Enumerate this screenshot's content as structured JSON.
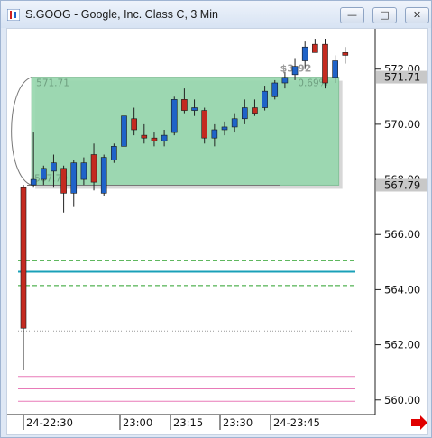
{
  "window": {
    "title": "S.GOOG - Google, Inc. Class C, 3 Min",
    "buttons": {
      "minimize": "—",
      "restore": "□",
      "close": "✕"
    }
  },
  "chart_data": {
    "type": "candlestick",
    "title": "",
    "xlabel": "",
    "ylabel": "",
    "ylim": [
      559.6,
      573.2
    ],
    "y_ticks": [
      560.0,
      562.0,
      564.0,
      566.0,
      568.0,
      570.0,
      572.0
    ],
    "x_ticks": [
      "24-22:30",
      "23:00",
      "23:15",
      "23:30",
      "24-23:45"
    ],
    "candles": [
      {
        "t": "22:30",
        "o": 567.7,
        "h": 567.8,
        "l": 561.1,
        "c": 562.6
      },
      {
        "t": "22:33",
        "o": 567.8,
        "h": 569.7,
        "l": 567.7,
        "c": 568.0
      },
      {
        "t": "22:36",
        "o": 568.0,
        "h": 568.5,
        "l": 567.8,
        "c": 568.4
      },
      {
        "t": "22:39",
        "o": 568.3,
        "h": 568.9,
        "l": 567.7,
        "c": 568.6
      },
      {
        "t": "22:42",
        "o": 568.4,
        "h": 568.5,
        "l": 566.8,
        "c": 567.5
      },
      {
        "t": "22:45",
        "o": 567.5,
        "h": 568.7,
        "l": 567.0,
        "c": 568.6
      },
      {
        "t": "22:48",
        "o": 568.0,
        "h": 568.8,
        "l": 567.8,
        "c": 568.6
      },
      {
        "t": "22:51",
        "o": 568.9,
        "h": 569.3,
        "l": 567.6,
        "c": 567.9
      },
      {
        "t": "22:54",
        "o": 567.5,
        "h": 568.9,
        "l": 567.4,
        "c": 568.8
      },
      {
        "t": "22:57",
        "o": 568.7,
        "h": 569.3,
        "l": 568.6,
        "c": 569.2
      },
      {
        "t": "23:00",
        "o": 569.2,
        "h": 570.6,
        "l": 569.1,
        "c": 570.3
      },
      {
        "t": "23:03",
        "o": 570.2,
        "h": 570.6,
        "l": 569.6,
        "c": 569.8
      },
      {
        "t": "23:06",
        "o": 569.6,
        "h": 570.0,
        "l": 569.3,
        "c": 569.5
      },
      {
        "t": "23:09",
        "o": 569.5,
        "h": 569.7,
        "l": 569.2,
        "c": 569.4
      },
      {
        "t": "23:12",
        "o": 569.4,
        "h": 569.8,
        "l": 569.2,
        "c": 569.6
      },
      {
        "t": "23:15",
        "o": 569.7,
        "h": 571.0,
        "l": 569.6,
        "c": 570.9
      },
      {
        "t": "23:18",
        "o": 570.9,
        "h": 571.3,
        "l": 570.4,
        "c": 570.5
      },
      {
        "t": "23:21",
        "o": 570.5,
        "h": 570.9,
        "l": 570.3,
        "c": 570.6
      },
      {
        "t": "23:24",
        "o": 570.5,
        "h": 570.6,
        "l": 569.3,
        "c": 569.5
      },
      {
        "t": "23:27",
        "o": 569.5,
        "h": 570.0,
        "l": 569.2,
        "c": 569.8
      },
      {
        "t": "23:30",
        "o": 569.8,
        "h": 570.1,
        "l": 569.6,
        "c": 569.9
      },
      {
        "t": "23:33",
        "o": 569.9,
        "h": 570.4,
        "l": 569.7,
        "c": 570.2
      },
      {
        "t": "23:36",
        "o": 570.2,
        "h": 570.9,
        "l": 570.0,
        "c": 570.6
      },
      {
        "t": "23:39",
        "o": 570.6,
        "h": 570.9,
        "l": 570.3,
        "c": 570.4
      },
      {
        "t": "23:42",
        "o": 570.6,
        "h": 571.4,
        "l": 570.5,
        "c": 571.2
      },
      {
        "t": "23:45",
        "o": 571.0,
        "h": 571.6,
        "l": 570.9,
        "c": 571.5
      },
      {
        "t": "23:48",
        "o": 571.5,
        "h": 571.9,
        "l": 571.3,
        "c": 571.7
      },
      {
        "t": "23:51",
        "o": 571.8,
        "h": 572.4,
        "l": 571.6,
        "c": 572.1
      },
      {
        "t": "23:54",
        "o": 572.3,
        "h": 573.0,
        "l": 572.0,
        "c": 572.8
      },
      {
        "t": "23:57",
        "o": 572.9,
        "h": 573.1,
        "l": 572.6,
        "c": 572.6
      },
      {
        "t": "24:00",
        "o": 572.9,
        "h": 573.1,
        "l": 571.3,
        "c": 571.5
      },
      {
        "t": "24:03",
        "o": 571.7,
        "h": 572.5,
        "l": 571.5,
        "c": 572.3
      },
      {
        "t": "24:06",
        "o": 572.6,
        "h": 572.8,
        "l": 572.2,
        "c": 572.5
      }
    ],
    "price_labels": {
      "high": "571.71",
      "low": "567.79"
    },
    "box": {
      "top_label": "571.71",
      "bottom_label": "567.79",
      "change": "$3.92",
      "percent": "0.69%",
      "start": "22:33",
      "end": "24:03",
      "top": 571.71,
      "bottom": 567.79
    },
    "lines": [
      {
        "name": "green-dash-upper",
        "value": 565.05,
        "color": "#2aa02a",
        "style": "dashed"
      },
      {
        "name": "teal-solid",
        "value": 564.65,
        "color": "#1aa0b8",
        "style": "solid"
      },
      {
        "name": "green-dash-lower",
        "value": 564.15,
        "color": "#2aa02a",
        "style": "dashed"
      },
      {
        "name": "gray-dotted",
        "value": 562.5,
        "color": "#999999",
        "style": "dotted"
      },
      {
        "name": "pink-1",
        "value": 560.85,
        "color": "#e87ab8",
        "style": "solid"
      },
      {
        "name": "pink-2",
        "value": 560.4,
        "color": "#e87ab8",
        "style": "solid"
      },
      {
        "name": "pink-3",
        "value": 559.95,
        "color": "#e87ab8",
        "style": "solid"
      }
    ],
    "colors": {
      "up": "#1f63c9",
      "down": "#c42a20",
      "box_fill": "#97d7ae",
      "label_bg": "#c8c8c8",
      "arrow": "#e00000"
    }
  }
}
